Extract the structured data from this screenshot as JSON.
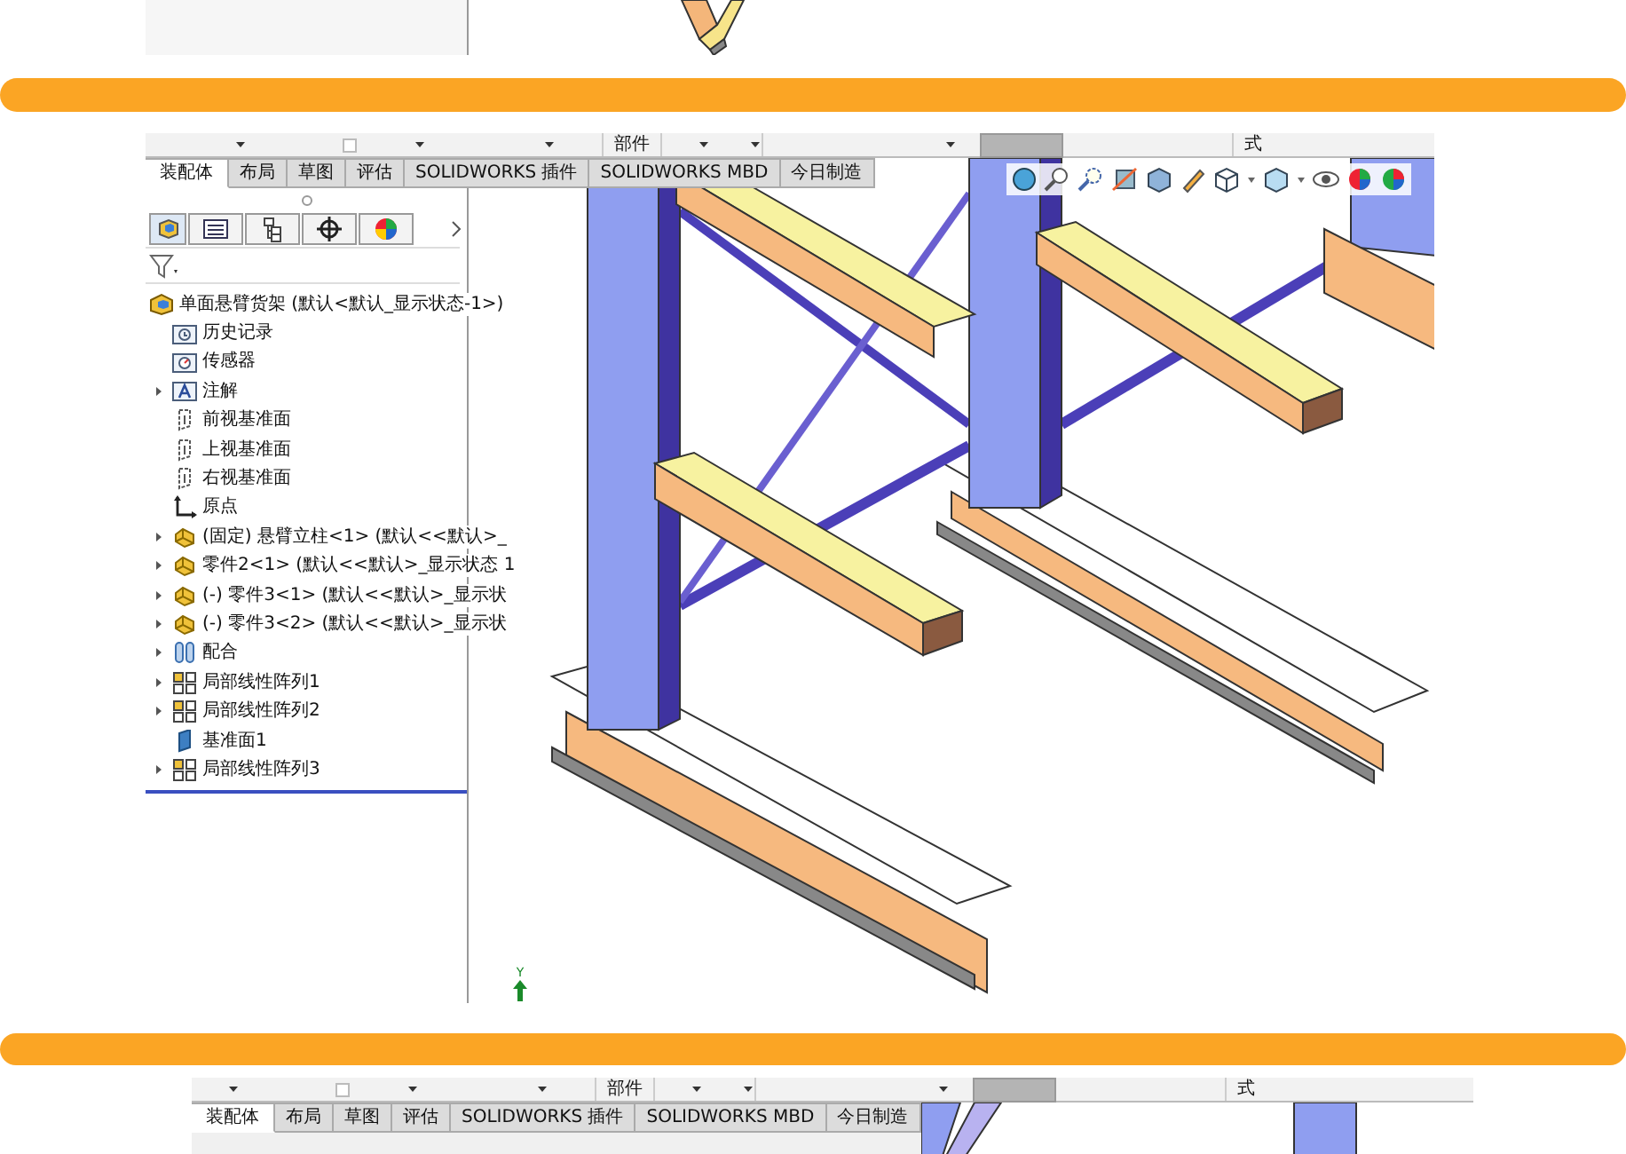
{
  "main": {
    "ribbon": {
      "text_1": "部件",
      "text_2": "式"
    },
    "tabs": [
      {
        "label": "装配体",
        "selected": true
      },
      {
        "label": "布局",
        "selected": false
      },
      {
        "label": "草图",
        "selected": false
      },
      {
        "label": "评估",
        "selected": false
      },
      {
        "label": "SOLIDWORKS 插件",
        "selected": false
      },
      {
        "label": "SOLIDWORKS MBD",
        "selected": false
      },
      {
        "label": "今日制造",
        "selected": false
      }
    ],
    "tree": {
      "label": "单面悬臂货架 (默认<默认_显示状态-1>)",
      "kind": "assembly",
      "children": [
        {
          "label": "历史记录",
          "kind": "history",
          "expandable": false
        },
        {
          "label": "传感器",
          "kind": "sensor",
          "expandable": false
        },
        {
          "label": "注解",
          "kind": "annotation",
          "expandable": true
        },
        {
          "label": "前视基准面",
          "kind": "plane",
          "expandable": false
        },
        {
          "label": "上视基准面",
          "kind": "plane",
          "expandable": false
        },
        {
          "label": "右视基准面",
          "kind": "plane",
          "expandable": false
        },
        {
          "label": "原点",
          "kind": "origin",
          "expandable": false
        },
        {
          "label": "(固定) 悬臂立柱<1> (默认<<默认>_",
          "kind": "part",
          "expandable": true
        },
        {
          "label": "零件2<1> (默认<<默认>_显示状态 1",
          "kind": "part",
          "expandable": true
        },
        {
          "label": "(-) 零件3<1> (默认<<默认>_显示状",
          "kind": "part",
          "expandable": true
        },
        {
          "label": "(-) 零件3<2> (默认<<默认>_显示状",
          "kind": "part",
          "expandable": true
        },
        {
          "label": "配合",
          "kind": "mate",
          "expandable": true
        },
        {
          "label": "局部线性阵列1",
          "kind": "pattern",
          "expandable": true
        },
        {
          "label": "局部线性阵列2",
          "kind": "pattern",
          "expandable": true
        },
        {
          "label": "基准面1",
          "kind": "datum_plane",
          "expandable": false
        },
        {
          "label": "局部线性阵列3",
          "kind": "pattern",
          "expandable": true
        }
      ]
    },
    "axis_label": "Y"
  },
  "bottom": {
    "ribbon": {
      "text_1": "部件",
      "text_2": "式"
    },
    "tabs": [
      {
        "label": "装配体",
        "selected": true
      },
      {
        "label": "布局",
        "selected": false
      },
      {
        "label": "草图",
        "selected": false
      },
      {
        "label": "评估",
        "selected": false
      },
      {
        "label": "SOLIDWORKS 插件",
        "selected": false
      },
      {
        "label": "SOLIDWORKS MBD",
        "selected": false
      },
      {
        "label": "今日制造",
        "selected": false
      }
    ]
  }
}
